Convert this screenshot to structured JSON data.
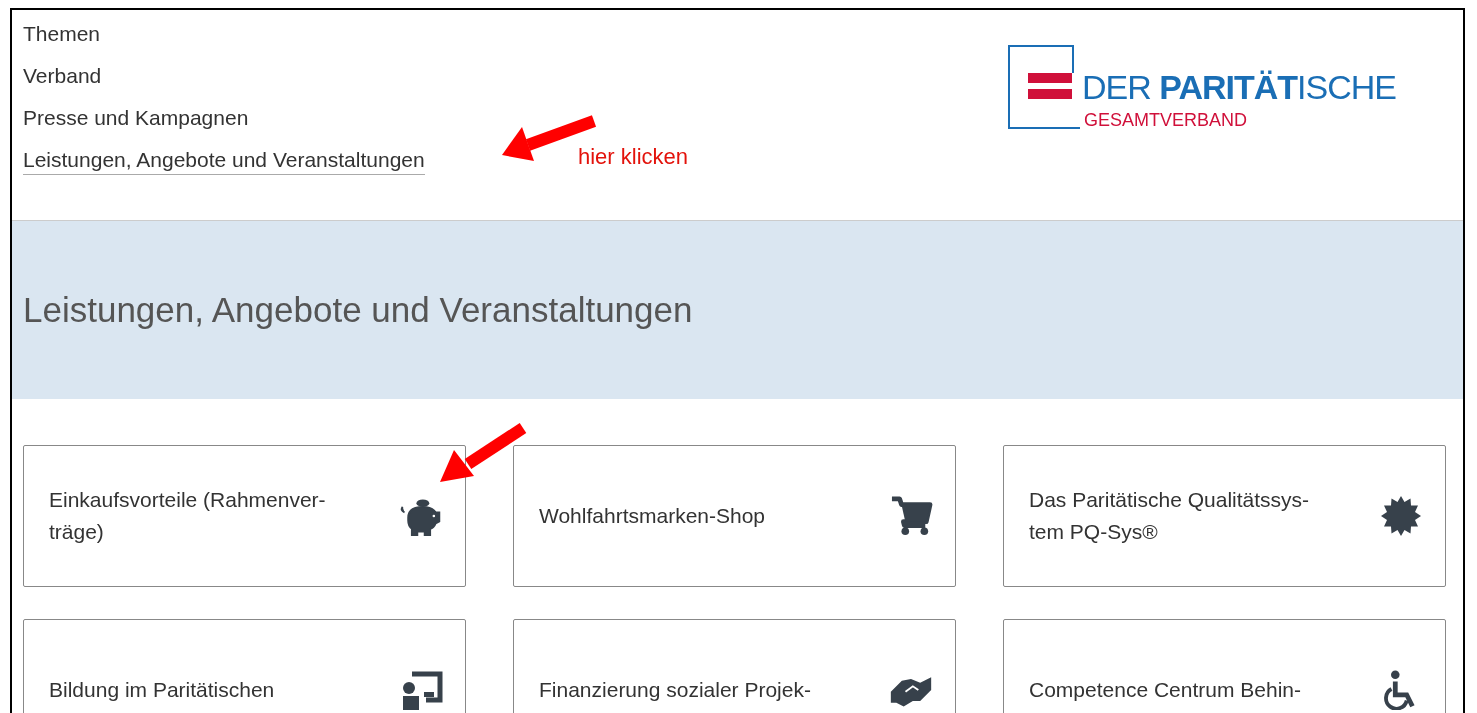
{
  "nav": [
    {
      "label": "Themen",
      "selected": false
    },
    {
      "label": "Verband",
      "selected": false
    },
    {
      "label": "Presse und Kampagnen",
      "selected": false
    },
    {
      "label": "Leistungen, Angebote und Veranstaltungen",
      "selected": true
    }
  ],
  "logo": {
    "title": "DER **PARITÄT**ISCHE",
    "subtitle": "GESAMTVERBAND"
  },
  "annotation_note": "hier klicken",
  "page_title": "Leistungen, Angebote und Veranstaltungen",
  "cards": [
    {
      "text": "Einkaufsvorteile (Rahmenver-\nträge)"
    },
    {
      "text": "Wohlfahrtsmarken-Shop"
    },
    {
      "text": "Das Paritätische Qualitätssys-\ntem PQ-Sys®"
    },
    {
      "text": "Bildung im Paritätischen"
    },
    {
      "text": "Finanzierung sozialer Projek-"
    },
    {
      "text": "Competence Centrum Behin-"
    }
  ]
}
